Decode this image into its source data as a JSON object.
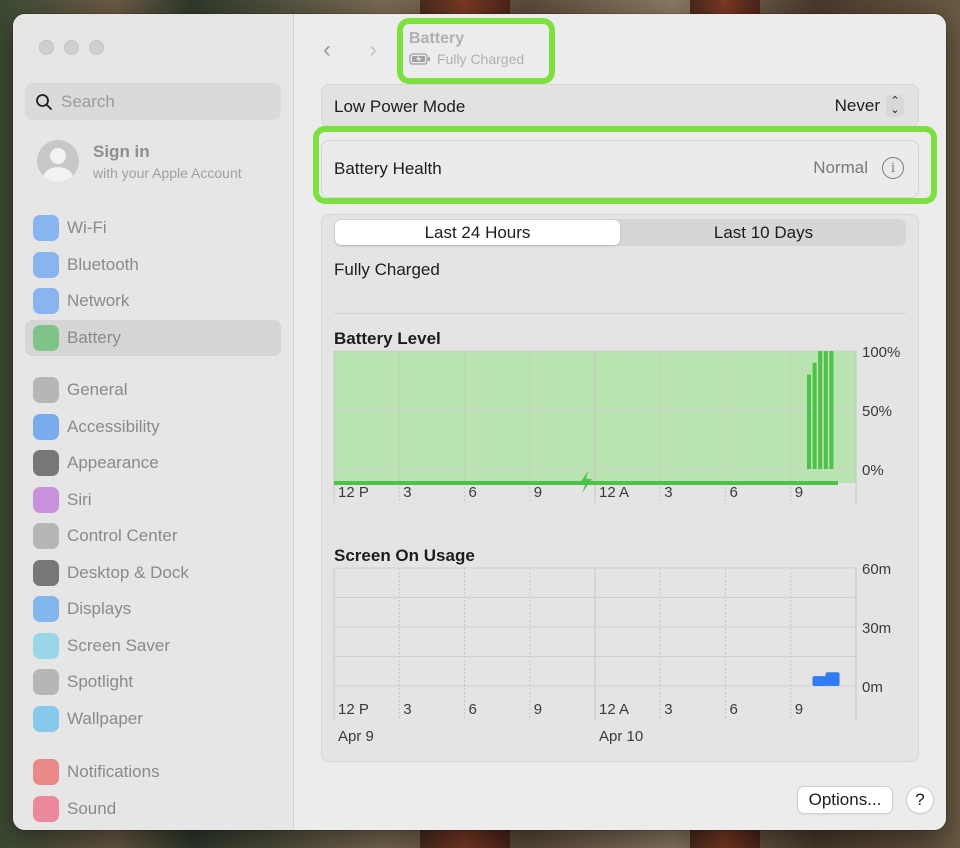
{
  "sidebar": {
    "search_placeholder": "Search",
    "signin_title": "Sign in",
    "signin_subtitle": "with your Apple Account",
    "items": [
      {
        "label": "Wi-Fi",
        "icon": "wifi-icon",
        "color": "#3b8cf5"
      },
      {
        "label": "Bluetooth",
        "icon": "bluetooth-icon",
        "color": "#3b8cf5"
      },
      {
        "label": "Network",
        "icon": "globe-icon",
        "color": "#3b8cf5"
      },
      {
        "label": "Battery",
        "icon": "battery-icon",
        "color": "#39b54a",
        "active": true
      },
      {
        "label": "General",
        "icon": "gear-icon",
        "color": "#8e8e93"
      },
      {
        "label": "Accessibility",
        "icon": "accessibility-icon",
        "color": "#1e7cf2"
      },
      {
        "label": "Appearance",
        "icon": "appearance-icon",
        "color": "#1c1c1e"
      },
      {
        "label": "Siri",
        "icon": "siri-icon",
        "color": "#b04bd6"
      },
      {
        "label": "Control Center",
        "icon": "control-center-icon",
        "color": "#8e8e93"
      },
      {
        "label": "Desktop & Dock",
        "icon": "dock-icon",
        "color": "#1c1c1e"
      },
      {
        "label": "Displays",
        "icon": "displays-icon",
        "color": "#2f8ef5"
      },
      {
        "label": "Screen Saver",
        "icon": "screen-saver-icon",
        "color": "#5ac8e8"
      },
      {
        "label": "Spotlight",
        "icon": "spotlight-icon",
        "color": "#8e8e93"
      },
      {
        "label": "Wallpaper",
        "icon": "wallpaper-icon",
        "color": "#35b3ee"
      },
      {
        "label": "Notifications",
        "icon": "notifications-icon",
        "color": "#ee3b3b"
      },
      {
        "label": "Sound",
        "icon": "sound-icon",
        "color": "#ee3b5c"
      }
    ]
  },
  "header": {
    "title": "Battery",
    "subtitle": "Fully Charged",
    "highlight_color": "#7ee040"
  },
  "low_power": {
    "label": "Low Power Mode",
    "value": "Never"
  },
  "battery_health": {
    "label": "Battery Health",
    "value": "Normal"
  },
  "usage": {
    "tabs": [
      "Last 24 Hours",
      "Last 10 Days"
    ],
    "selected_tab": "Last 24 Hours",
    "status": "Fully Charged"
  },
  "chart_data": [
    {
      "type": "bar",
      "title": "Battery Level",
      "x_ticks": [
        "12 P",
        "3",
        "6",
        "9",
        "12 A",
        "3",
        "6",
        "9"
      ],
      "y_ticks": [
        "100%",
        "50%",
        "0%"
      ],
      "ylim": [
        0,
        100
      ],
      "values_last_hour_bars": [
        80,
        90,
        100,
        100,
        100
      ],
      "charging_indicator": true,
      "grid": true,
      "colors": {
        "fill": "#b9e3b1",
        "bar": "#4cc24a",
        "charging": "#4cc24a"
      }
    },
    {
      "type": "bar",
      "title": "Screen On Usage",
      "x_ticks": [
        "12 P",
        "3",
        "6",
        "9",
        "12 A",
        "3",
        "6",
        "9"
      ],
      "date_labels": [
        "Apr 9",
        "Apr 10"
      ],
      "y_ticks": [
        "60m",
        "30m",
        "0m"
      ],
      "ylim": [
        0,
        60
      ],
      "bars": [
        {
          "slot": 22.0,
          "minutes": 5
        },
        {
          "slot": 22.6,
          "minutes": 7
        }
      ],
      "grid": true,
      "colors": {
        "bar": "#2f7cf6"
      }
    }
  ],
  "footer": {
    "options_label": "Options...",
    "help_label": "?"
  }
}
